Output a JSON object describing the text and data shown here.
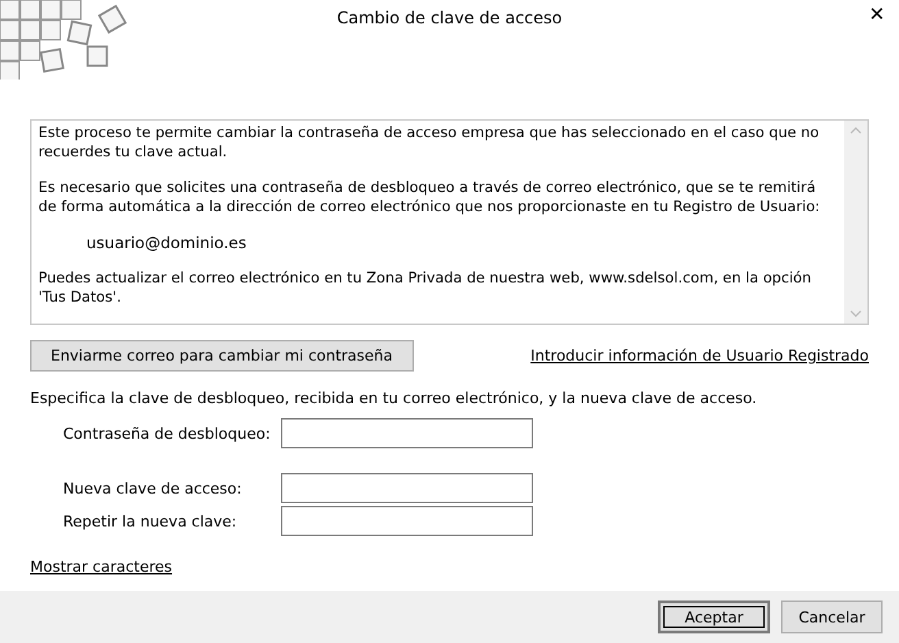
{
  "window": {
    "title": "Cambio de clave de acceso",
    "close": "✕"
  },
  "info": {
    "paragraphs": [
      {
        "kind": "text",
        "text": "Este proceso te permite cambiar la contraseña de acceso empresa que has seleccionado en el caso que no recuerdes tu clave actual."
      },
      {
        "kind": "text",
        "text": "Es necesario que solicites una contraseña de desbloqueo a través de correo electrónico, que se te remitirá de forma automática a la dirección de correo electrónico que nos proporcionaste en tu Registro de Usuario:"
      },
      {
        "kind": "email",
        "text": "usuario@dominio.es"
      },
      {
        "kind": "text",
        "text": "Puedes actualizar el correo electrónico en tu Zona Privada de nuestra web, www.sdelsol.com, en la opción 'Tus Datos'."
      }
    ]
  },
  "send_button": "Enviarme correo para cambiar mi contraseña",
  "register_link": "Introducir información de Usuario Registrado",
  "instruction": "Especifica la clave de desbloqueo, recibida en tu correo electrónico, y la nueva clave de acceso.",
  "fields": [
    {
      "label": "Contraseña de desbloqueo:"
    },
    {
      "label": "Nueva clave de acceso:"
    },
    {
      "label": "Repetir la nueva clave:"
    }
  ],
  "show_link": "Mostrar caracteres",
  "buttons": [
    {
      "label": "Aceptar",
      "default": true
    },
    {
      "label": "Cancelar",
      "default": false
    }
  ]
}
